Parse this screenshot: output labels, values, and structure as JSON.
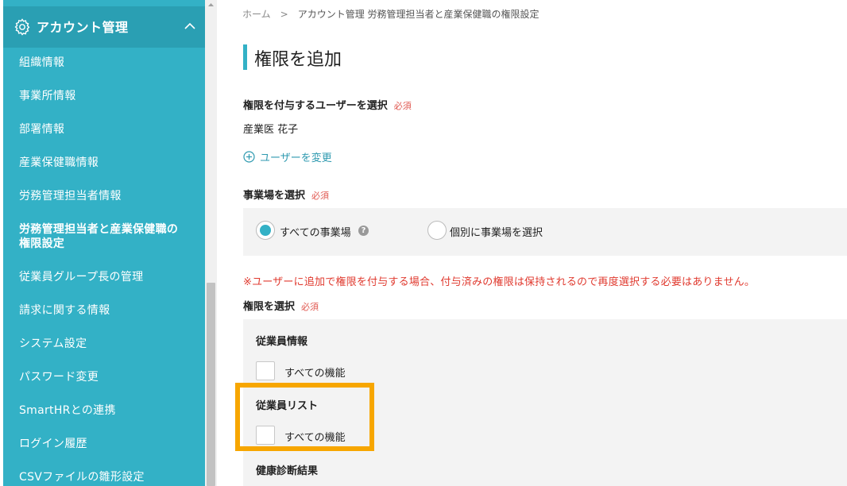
{
  "sidebar": {
    "header_title": "アカウント管理",
    "header_icon": "gear-icon",
    "collapse_icon": "chevron-up-icon",
    "items": [
      {
        "label": "組織情報",
        "active": false
      },
      {
        "label": "事業所情報",
        "active": false
      },
      {
        "label": "部署情報",
        "active": false
      },
      {
        "label": "産業保健職情報",
        "active": false
      },
      {
        "label": "労務管理担当者情報",
        "active": false
      },
      {
        "label": "労務管理担当者と産業保健職の",
        "label2": "権限設定",
        "active": true
      },
      {
        "label": "従業員グループ長の管理",
        "active": false
      },
      {
        "label": "請求に関する情報",
        "active": false
      },
      {
        "label": "システム設定",
        "active": false
      },
      {
        "label": "パスワード変更",
        "active": false
      },
      {
        "label": "SmartHRとの連携",
        "active": false
      },
      {
        "label": "ログイン履歴",
        "active": false
      },
      {
        "label": "CSVファイルの雛形設定",
        "active": false
      }
    ]
  },
  "breadcrumb": {
    "home": "ホーム",
    "separator": ">",
    "current": "アカウント管理 労務管理担当者と産業保健職の権限設定"
  },
  "page": {
    "title": "権限を追加"
  },
  "user_section": {
    "label": "権限を付与するユーザーを選択",
    "required": "必須",
    "selected_user": "産業医 花子",
    "change_link": "ユーザーを変更"
  },
  "site_section": {
    "label": "事業場を選択",
    "required": "必須",
    "options": [
      {
        "label": "すべての事業場",
        "checked": true
      },
      {
        "label": "個別に事業場を選択",
        "checked": false
      }
    ],
    "help": "?"
  },
  "notice": "※ユーザーに追加で権限を付与する場合、付与済みの権限は保持されるので再度選択する必要はありません。",
  "permission_section": {
    "label": "権限を選択",
    "required": "必須",
    "groups": [
      {
        "title": "従業員情報",
        "option": "すべての機能",
        "checked": false
      },
      {
        "title": "従業員リスト",
        "option": "すべての機能",
        "checked": false
      },
      {
        "title": "健康診断結果"
      }
    ]
  },
  "colors": {
    "sidebar": "#33b1c6",
    "sidebar_header": "#2a9fb3",
    "accent": "#33b1c6",
    "required": "#e0574f",
    "notice": "#e03a2f",
    "highlight": "#f7a600"
  }
}
